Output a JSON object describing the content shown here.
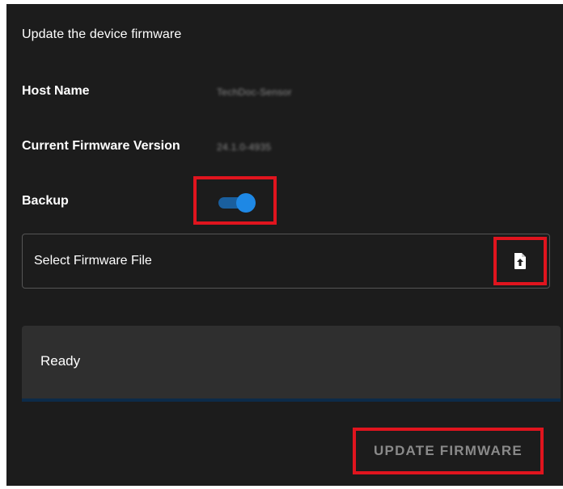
{
  "panel": {
    "title": "Update the device firmware"
  },
  "host_name": {
    "label": "Host Name",
    "value": "TechDoc-Sensor"
  },
  "firmware_version": {
    "label": "Current Firmware Version",
    "value": "24.1.0-4935"
  },
  "backup": {
    "label": "Backup",
    "enabled": true,
    "accent_color": "#1e88e5"
  },
  "file_select": {
    "label": "Select Firmware File",
    "icon": "file-upload-icon"
  },
  "status": {
    "text": "Ready",
    "progress": 0
  },
  "actions": {
    "update_label": "UPDATE FIRMWARE"
  },
  "colors": {
    "panel_bg": "#1c1c1c",
    "status_bg": "#2f2f2f",
    "highlight": "#e0141e",
    "disabled_text": "#8a8a8a"
  }
}
